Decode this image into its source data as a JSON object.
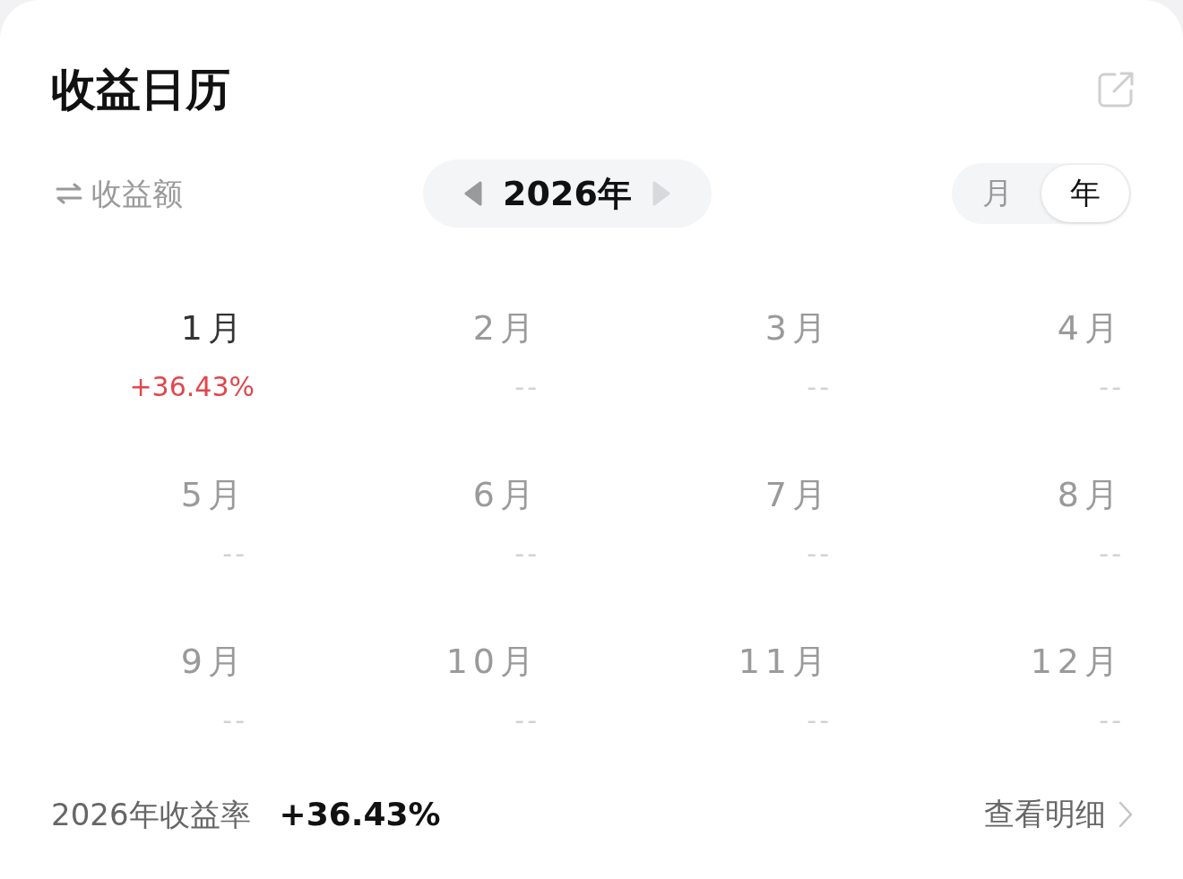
{
  "header": {
    "title": "收益日历"
  },
  "controls": {
    "metric_toggle": {
      "label": "收益额"
    },
    "year_nav": {
      "label": "2026年",
      "prev_disabled": false,
      "next_disabled": true
    },
    "period_tabs": [
      {
        "label": "月",
        "selected": false
      },
      {
        "label": "年",
        "selected": true
      }
    ]
  },
  "months": [
    {
      "label": "1月",
      "value": "+36.43%",
      "has_data": true
    },
    {
      "label": "2月",
      "value": "--",
      "has_data": false
    },
    {
      "label": "3月",
      "value": "--",
      "has_data": false
    },
    {
      "label": "4月",
      "value": "--",
      "has_data": false
    },
    {
      "label": "5月",
      "value": "--",
      "has_data": false
    },
    {
      "label": "6月",
      "value": "--",
      "has_data": false
    },
    {
      "label": "7月",
      "value": "--",
      "has_data": false
    },
    {
      "label": "8月",
      "value": "--",
      "has_data": false
    },
    {
      "label": "9月",
      "value": "--",
      "has_data": false
    },
    {
      "label": "10月",
      "value": "--",
      "has_data": false
    },
    {
      "label": "11月",
      "value": "--",
      "has_data": false
    },
    {
      "label": "12月",
      "value": "--",
      "has_data": false
    }
  ],
  "footer": {
    "label": "2026年收益率",
    "value": "+36.43%",
    "link": "查看明细"
  }
}
